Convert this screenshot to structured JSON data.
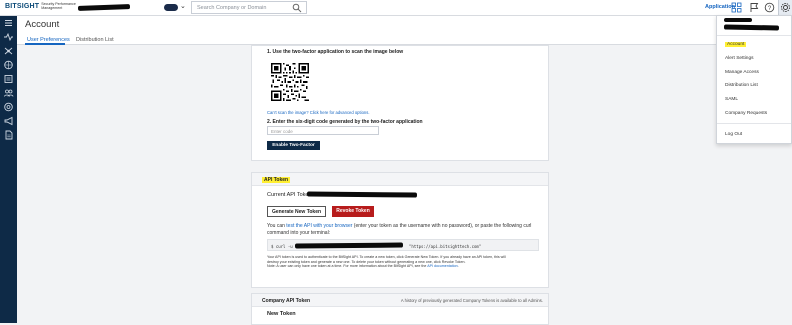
{
  "topbar": {
    "logo_main": "BITSIGHT",
    "logo_sub": "Security Performance Management",
    "search_placeholder": "Search Company or Domain",
    "application_link": "Application"
  },
  "header": {
    "page_title": "Account",
    "tabs": [
      {
        "label": "User Preferences",
        "active": true
      },
      {
        "label": "Distribution List",
        "active": false
      }
    ]
  },
  "two_factor": {
    "step1": "1. Use the two-factor application to scan the image below",
    "cant_scan": "Can't scan the image? Click here for advanced options.",
    "step2": "2. Enter the six-digit code generated by the two-factor application",
    "code_placeholder": "Enter code",
    "enable_button": "Enable Two-Factor"
  },
  "api_token": {
    "section_title": "API Token",
    "current_label": "Current API Token:",
    "generate_button": "Generate New Token",
    "revoke_button": "Revoke Token",
    "instr_prefix": "You can ",
    "instr_link": "test the API with your browser",
    "instr_suffix": " (enter your token as the username with no password), or paste the following curl command into your terminal:",
    "curl_prefix": "$ curl -u",
    "curl_url": "\"https://api.bitsighttech.com\"",
    "note_1": "Your API token is used to authenticate to the BitSight API. To create a new token, click Generate New Token. If you already have an API token, this will",
    "note_2": "destroy your existing token and generate a new one. To delete your token without generating a new one, click Revoke Token.",
    "note_3_prefix": "Note: A user can only have one token at a time. For more information about the BitSight API, see the ",
    "note_3_link": "API documentation",
    "note_3_suffix": "."
  },
  "company_token": {
    "section_title": "Company API Token",
    "history_note": "A history of previously generated Company Tokens is available to all Admins.",
    "new_token": "New Token"
  },
  "user_menu": {
    "items": [
      "Account",
      "Alert Settings",
      "Manage Access",
      "Distribution List",
      "SAML",
      "Company Requests"
    ],
    "logout": "Log Out"
  },
  "colors": {
    "navy": "#0e2a47",
    "link": "#1565c0",
    "highlight": "#ffef33",
    "danger": "#b71c1c"
  }
}
